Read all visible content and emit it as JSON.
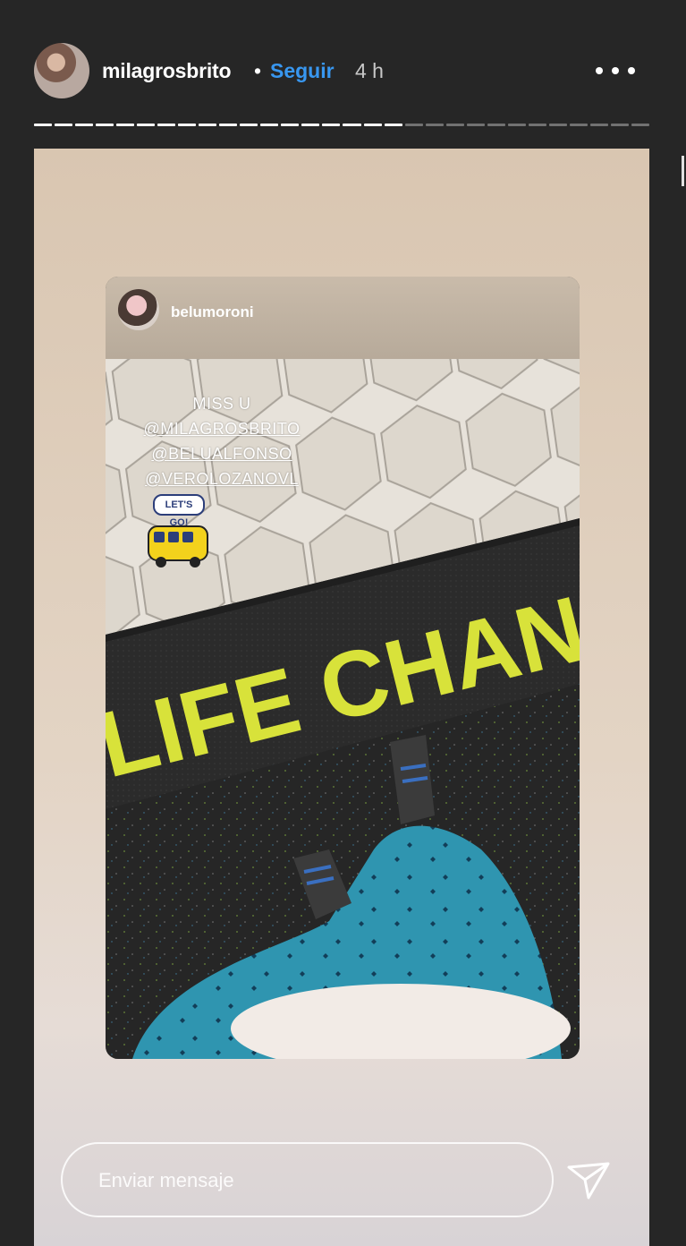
{
  "header": {
    "username": "milagrosbrito",
    "separator": "•",
    "follow_label": "Seguir",
    "time": "4 h",
    "more_icon": "more-horizontal-icon"
  },
  "progress": {
    "segments": 30,
    "viewed": 18
  },
  "story": {
    "shared_post": {
      "username": "belumoroni",
      "caption": [
        "MISS U",
        "@MILAGROSBRITO",
        "@BELUALFONSO",
        "@VEROLOZANOVL"
      ],
      "sticker": {
        "label": "LET'S GO!",
        "icon": "bus-icon"
      },
      "mat_text": "LIFE CHANGE"
    }
  },
  "reply": {
    "placeholder": "Enviar mensaje",
    "send_icon": "send-paper-plane-icon"
  },
  "colors": {
    "background": "#262626",
    "follow": "#3897f0",
    "mat_text": "#d8e23a",
    "leggings": "#2f95b0"
  }
}
